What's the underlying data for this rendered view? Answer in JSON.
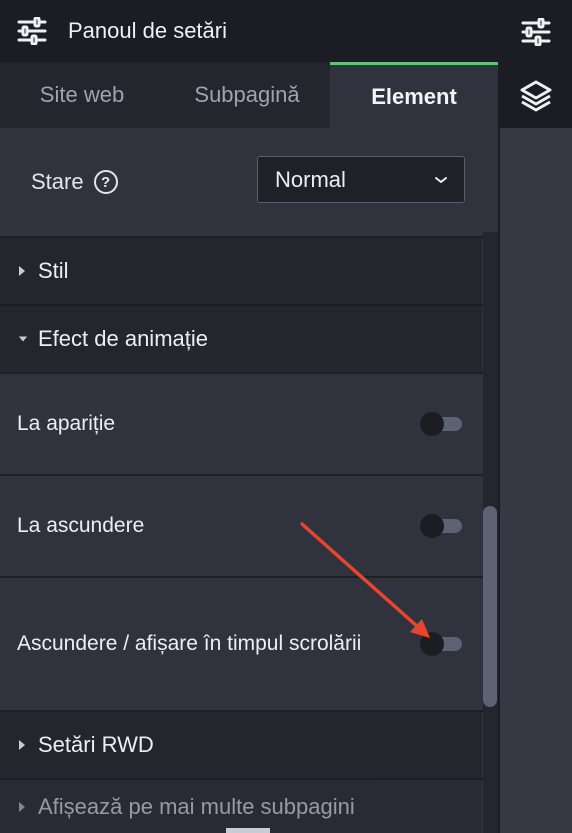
{
  "header": {
    "title": "Panoul de setări",
    "icon": "sliders-icon"
  },
  "tabs": [
    {
      "label": "Site web",
      "active": false
    },
    {
      "label": "Subpagină",
      "active": false
    },
    {
      "label": "Element",
      "active": true
    }
  ],
  "state": {
    "label": "Stare",
    "help_icon": "question-circle-icon",
    "selected": "Normal"
  },
  "sections": {
    "style": {
      "label": "Stil",
      "expanded": false
    },
    "animation": {
      "label": "Efect de animație",
      "expanded": true
    },
    "rwd": {
      "label": "Setări RWD",
      "expanded": false
    },
    "multi": {
      "label": "Afișează pe mai multe subpagini",
      "expanded": false
    }
  },
  "animation_options": [
    {
      "label": "La apariție",
      "enabled": false
    },
    {
      "label": "La ascundere",
      "enabled": false
    },
    {
      "label": "Ascundere / afișare în timpul scrolării",
      "enabled": false
    }
  ],
  "rail": {
    "top_icon": "sliders-icon",
    "layers_icon": "layers-icon"
  },
  "colors": {
    "accent": "#5cc57a",
    "arrow": "#e8452e",
    "toggle_track": "#5c6274"
  }
}
